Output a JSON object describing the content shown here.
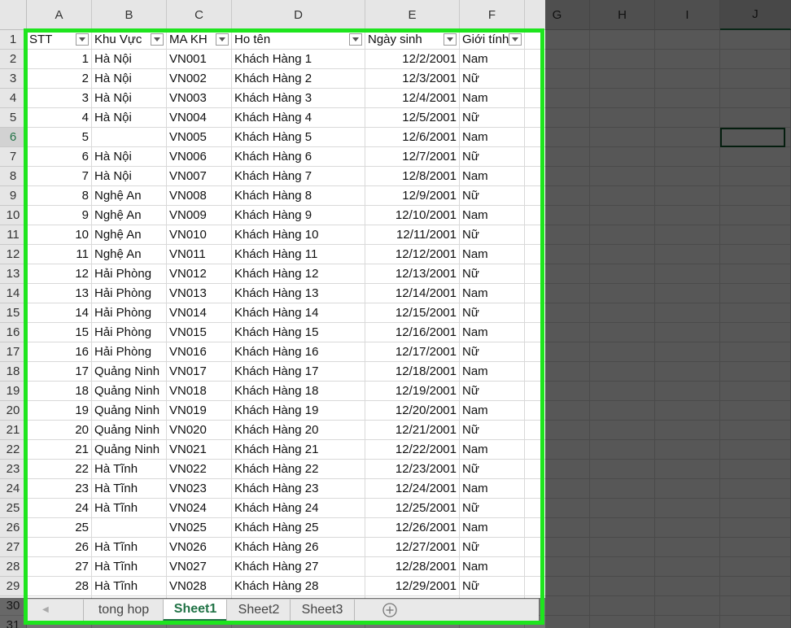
{
  "column_headers": [
    "A",
    "B",
    "C",
    "D",
    "E",
    "F",
    "G",
    "H",
    "I",
    "J"
  ],
  "table_headers": [
    "STT",
    "Khu Vực",
    "MA KH",
    "Ho tên",
    "Ngày sinh",
    "Giới tính"
  ],
  "rows": [
    {
      "stt": "1",
      "khu_vuc": "Hà Nội",
      "ma_kh": "VN001",
      "ho_ten": "Khách Hàng 1",
      "ngay_sinh": "12/2/2001",
      "gioi_tinh": "Nam"
    },
    {
      "stt": "2",
      "khu_vuc": "Hà Nội",
      "ma_kh": "VN002",
      "ho_ten": "Khách Hàng 2",
      "ngay_sinh": "12/3/2001",
      "gioi_tinh": "Nữ"
    },
    {
      "stt": "3",
      "khu_vuc": "Hà Nội",
      "ma_kh": "VN003",
      "ho_ten": "Khách Hàng 3",
      "ngay_sinh": "12/4/2001",
      "gioi_tinh": "Nam"
    },
    {
      "stt": "4",
      "khu_vuc": "Hà Nội",
      "ma_kh": "VN004",
      "ho_ten": "Khách Hàng 4",
      "ngay_sinh": "12/5/2001",
      "gioi_tinh": "Nữ"
    },
    {
      "stt": "5",
      "khu_vuc": "",
      "ma_kh": "VN005",
      "ho_ten": "Khách Hàng 5",
      "ngay_sinh": "12/6/2001",
      "gioi_tinh": "Nam"
    },
    {
      "stt": "6",
      "khu_vuc": "Hà Nội",
      "ma_kh": "VN006",
      "ho_ten": "Khách Hàng 6",
      "ngay_sinh": "12/7/2001",
      "gioi_tinh": "Nữ"
    },
    {
      "stt": "7",
      "khu_vuc": "Hà Nội",
      "ma_kh": "VN007",
      "ho_ten": "Khách Hàng 7",
      "ngay_sinh": "12/8/2001",
      "gioi_tinh": "Nam"
    },
    {
      "stt": "8",
      "khu_vuc": "Nghệ An",
      "ma_kh": "VN008",
      "ho_ten": "Khách Hàng 8",
      "ngay_sinh": "12/9/2001",
      "gioi_tinh": "Nữ"
    },
    {
      "stt": "9",
      "khu_vuc": "Nghệ An",
      "ma_kh": "VN009",
      "ho_ten": "Khách Hàng 9",
      "ngay_sinh": "12/10/2001",
      "gioi_tinh": "Nam"
    },
    {
      "stt": "10",
      "khu_vuc": "Nghệ An",
      "ma_kh": "VN010",
      "ho_ten": "Khách Hàng 10",
      "ngay_sinh": "12/11/2001",
      "gioi_tinh": "Nữ"
    },
    {
      "stt": "11",
      "khu_vuc": "Nghệ An",
      "ma_kh": "VN011",
      "ho_ten": "Khách Hàng 11",
      "ngay_sinh": "12/12/2001",
      "gioi_tinh": "Nam"
    },
    {
      "stt": "12",
      "khu_vuc": "Hải Phòng",
      "ma_kh": "VN012",
      "ho_ten": "Khách Hàng 12",
      "ngay_sinh": "12/13/2001",
      "gioi_tinh": "Nữ"
    },
    {
      "stt": "13",
      "khu_vuc": "Hải Phòng",
      "ma_kh": "VN013",
      "ho_ten": "Khách Hàng 13",
      "ngay_sinh": "12/14/2001",
      "gioi_tinh": "Nam"
    },
    {
      "stt": "14",
      "khu_vuc": "Hải Phòng",
      "ma_kh": "VN014",
      "ho_ten": "Khách Hàng 14",
      "ngay_sinh": "12/15/2001",
      "gioi_tinh": "Nữ"
    },
    {
      "stt": "15",
      "khu_vuc": "Hải Phòng",
      "ma_kh": "VN015",
      "ho_ten": "Khách Hàng 15",
      "ngay_sinh": "12/16/2001",
      "gioi_tinh": "Nam"
    },
    {
      "stt": "16",
      "khu_vuc": "Hải Phòng",
      "ma_kh": "VN016",
      "ho_ten": "Khách Hàng 16",
      "ngay_sinh": "12/17/2001",
      "gioi_tinh": "Nữ"
    },
    {
      "stt": "17",
      "khu_vuc": "Quảng Ninh",
      "ma_kh": "VN017",
      "ho_ten": "Khách Hàng 17",
      "ngay_sinh": "12/18/2001",
      "gioi_tinh": "Nam"
    },
    {
      "stt": "18",
      "khu_vuc": "Quảng Ninh",
      "ma_kh": "VN018",
      "ho_ten": "Khách Hàng 18",
      "ngay_sinh": "12/19/2001",
      "gioi_tinh": "Nữ"
    },
    {
      "stt": "19",
      "khu_vuc": "Quảng Ninh",
      "ma_kh": "VN019",
      "ho_ten": "Khách Hàng 19",
      "ngay_sinh": "12/20/2001",
      "gioi_tinh": "Nam"
    },
    {
      "stt": "20",
      "khu_vuc": "Quảng Ninh",
      "ma_kh": "VN020",
      "ho_ten": "Khách Hàng 20",
      "ngay_sinh": "12/21/2001",
      "gioi_tinh": "Nữ"
    },
    {
      "stt": "21",
      "khu_vuc": "Quảng Ninh",
      "ma_kh": "VN021",
      "ho_ten": "Khách Hàng 21",
      "ngay_sinh": "12/22/2001",
      "gioi_tinh": "Nam"
    },
    {
      "stt": "22",
      "khu_vuc": "Hà Tĩnh",
      "ma_kh": "VN022",
      "ho_ten": "Khách Hàng 22",
      "ngay_sinh": "12/23/2001",
      "gioi_tinh": "Nữ"
    },
    {
      "stt": "23",
      "khu_vuc": "Hà Tĩnh",
      "ma_kh": "VN023",
      "ho_ten": "Khách Hàng 23",
      "ngay_sinh": "12/24/2001",
      "gioi_tinh": "Nam"
    },
    {
      "stt": "24",
      "khu_vuc": "Hà Tĩnh",
      "ma_kh": "VN024",
      "ho_ten": "Khách Hàng 24",
      "ngay_sinh": "12/25/2001",
      "gioi_tinh": "Nữ"
    },
    {
      "stt": "25",
      "khu_vuc": "",
      "ma_kh": "VN025",
      "ho_ten": "Khách Hàng 25",
      "ngay_sinh": "12/26/2001",
      "gioi_tinh": "Nam"
    },
    {
      "stt": "26",
      "khu_vuc": "Hà Tĩnh",
      "ma_kh": "VN026",
      "ho_ten": "Khách Hàng 26",
      "ngay_sinh": "12/27/2001",
      "gioi_tinh": "Nữ"
    },
    {
      "stt": "27",
      "khu_vuc": "Hà Tĩnh",
      "ma_kh": "VN027",
      "ho_ten": "Khách Hàng 27",
      "ngay_sinh": "12/28/2001",
      "gioi_tinh": "Nam"
    },
    {
      "stt": "28",
      "khu_vuc": "Hà Tĩnh",
      "ma_kh": "VN028",
      "ho_ten": "Khách Hàng 28",
      "ngay_sinh": "12/29/2001",
      "gioi_tinh": "Nữ"
    }
  ],
  "sheet_tabs": [
    "tong hop",
    "Sheet1",
    "Sheet2",
    "Sheet3"
  ],
  "active_tab": "Sheet1",
  "active_cell": "J6",
  "colors": {
    "highlight": "#1ee51e",
    "accent": "#217346"
  },
  "icons": {
    "filter": "filter-dropdown-icon",
    "add_sheet": "plus-circle-icon",
    "scroll_left": "triangle-left-icon"
  }
}
